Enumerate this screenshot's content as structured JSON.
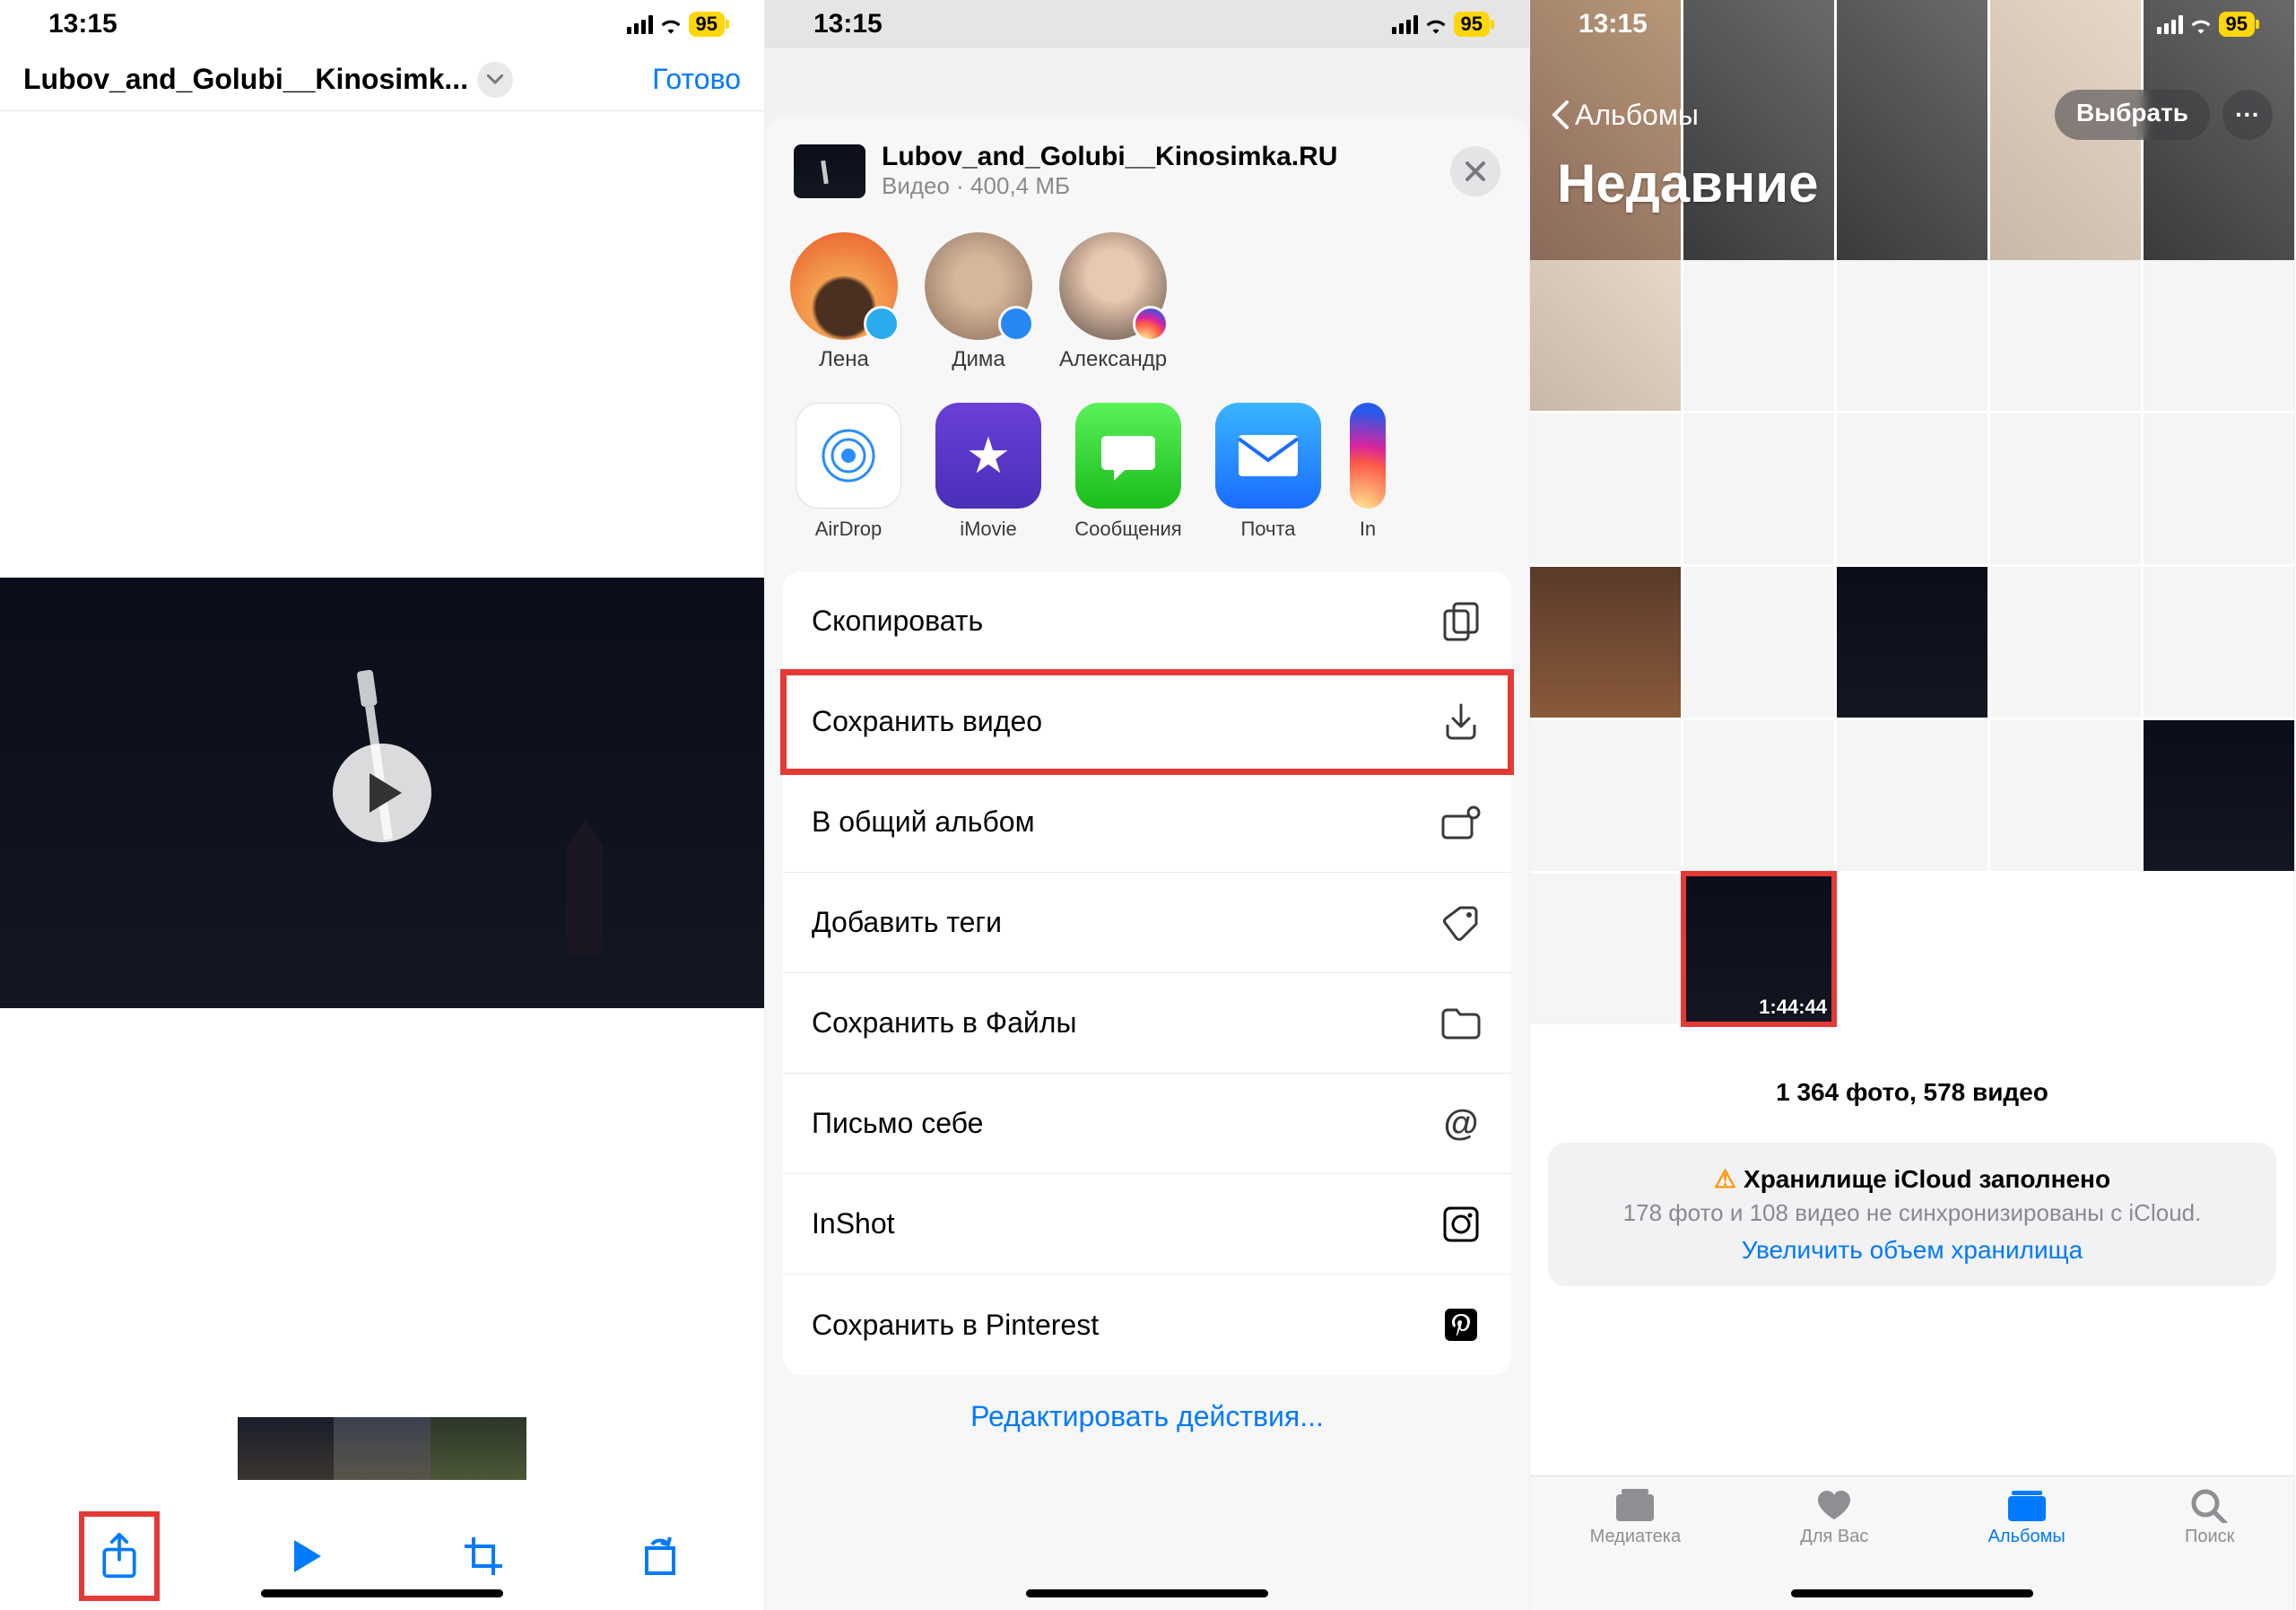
{
  "status": {
    "time": "13:15",
    "battery": "95"
  },
  "phone1": {
    "file_title": "Lubov_and_Golubi__Kinosimk...",
    "done": "Готово"
  },
  "phone2": {
    "sheet_title": "Lubov_and_Golubi__Kinosimka.RU",
    "sheet_sub": "Видео · 400,4 МБ",
    "contacts": [
      {
        "name": "Лена"
      },
      {
        "name": "Дима"
      },
      {
        "name": "Александр"
      }
    ],
    "apps": [
      {
        "label": "AirDrop"
      },
      {
        "label": "iMovie"
      },
      {
        "label": "Сообщения"
      },
      {
        "label": "Почта"
      },
      {
        "label": "In"
      }
    ],
    "actions": [
      {
        "label": "Скопировать",
        "icon": "copy"
      },
      {
        "label": "Сохранить видео",
        "icon": "download"
      },
      {
        "label": "В общий альбом",
        "icon": "shared-album"
      },
      {
        "label": "Добавить теги",
        "icon": "tag"
      },
      {
        "label": "Сохранить в Файлы",
        "icon": "folder"
      },
      {
        "label": "Письмо себе",
        "icon": "at"
      },
      {
        "label": "InShot",
        "icon": "inshot"
      },
      {
        "label": "Сохранить в Pinterest",
        "icon": "pinterest"
      }
    ],
    "edit": "Редактировать действия..."
  },
  "phone3": {
    "back": "Альбомы",
    "title": "Недавние",
    "select": "Выбрать",
    "video_duration": "1:44:44",
    "counts": "1 364 фото, 578 видео",
    "banner_title": "Хранилище iCloud заполнено",
    "banner_sub": "178 фото и 108 видео не синхронизированы с iCloud.",
    "banner_link": "Увеличить объем хранилища",
    "tabs": [
      {
        "label": "Медиатека"
      },
      {
        "label": "Для Вас"
      },
      {
        "label": "Альбомы"
      },
      {
        "label": "Поиск"
      }
    ]
  }
}
